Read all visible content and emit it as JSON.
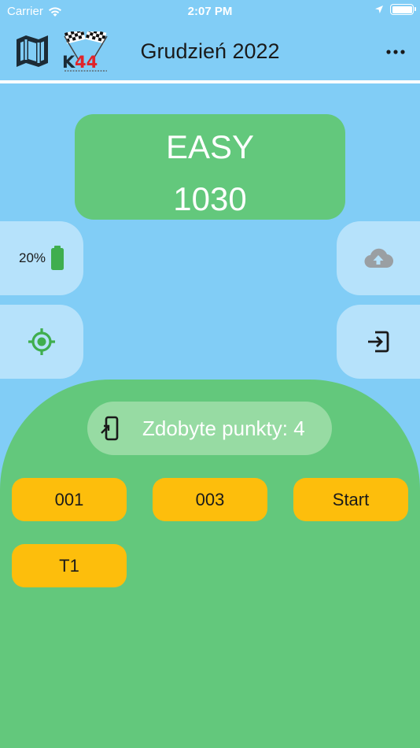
{
  "status_bar": {
    "carrier": "Carrier",
    "time": "2:07 PM"
  },
  "header": {
    "title": "Grudzień 2022",
    "logo_text": "K44"
  },
  "level": {
    "name": "EASY",
    "score": "1030"
  },
  "battery": {
    "percent_label": "20%",
    "level": 0.2
  },
  "points": {
    "label": "Zdobyte punkty: 4"
  },
  "checkpoints": [
    "001",
    "003",
    "Start",
    "T1"
  ],
  "colors": {
    "background": "#81cdf6",
    "card_green": "#63c87c",
    "pill_light": "#b6e2fb",
    "checkpoint_yellow": "#fdbe0c",
    "battery_green": "#3fae4e",
    "locate_green": "#3fae4e"
  }
}
